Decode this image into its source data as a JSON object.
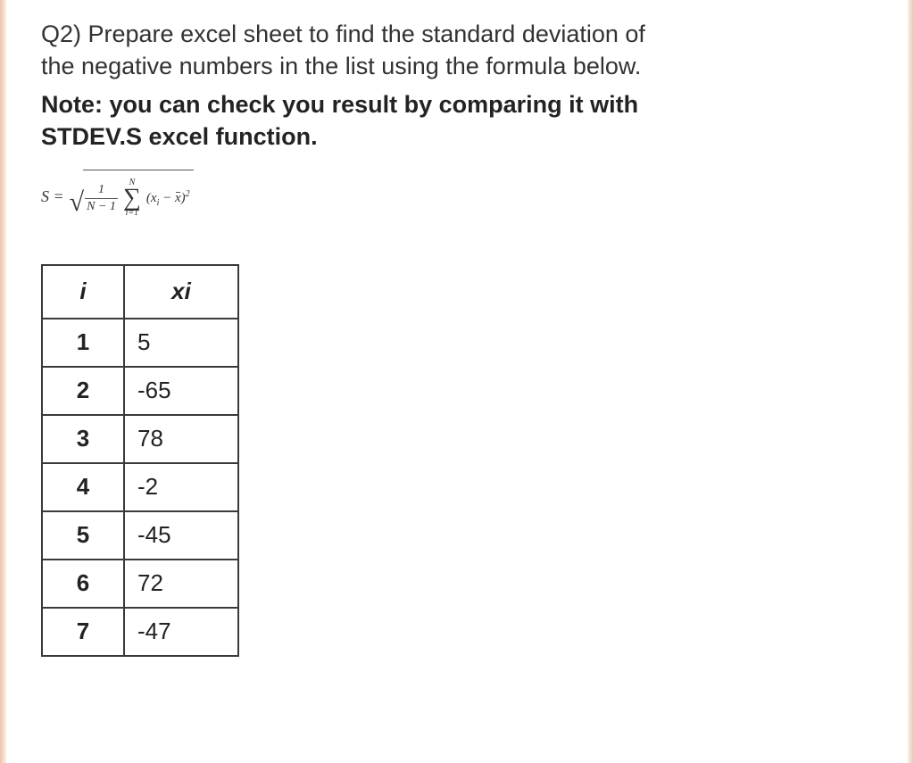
{
  "question": {
    "label": "Q2)",
    "prompt_line1": "Q2) Prepare excel sheet to find the standard deviation of",
    "prompt_line2": "the negative numbers in the list using the formula below.",
    "note_line1": "Note: you can check you result by comparing it with",
    "note_line2": "STDEV.S excel function."
  },
  "formula": {
    "lhs": "S =",
    "frac_num": "1",
    "frac_den": "N − 1",
    "sigma_above": "N",
    "sigma_below": "i=1",
    "sum_term_open": "(",
    "sum_term_xi": "x",
    "sum_term_xi_sub": "i",
    "sum_term_minus": " − ",
    "sum_term_xbar": "x",
    "sum_term_close": ")",
    "sum_term_exp": "2"
  },
  "table": {
    "headers": {
      "i": "i",
      "xi": "xi"
    },
    "rows": [
      {
        "i": "1",
        "xi": "5"
      },
      {
        "i": "2",
        "xi": "-65"
      },
      {
        "i": "3",
        "xi": "78"
      },
      {
        "i": "4",
        "xi": "-2"
      },
      {
        "i": "5",
        "xi": "-45"
      },
      {
        "i": "6",
        "xi": "72"
      },
      {
        "i": "7",
        "xi": "-47"
      }
    ]
  }
}
